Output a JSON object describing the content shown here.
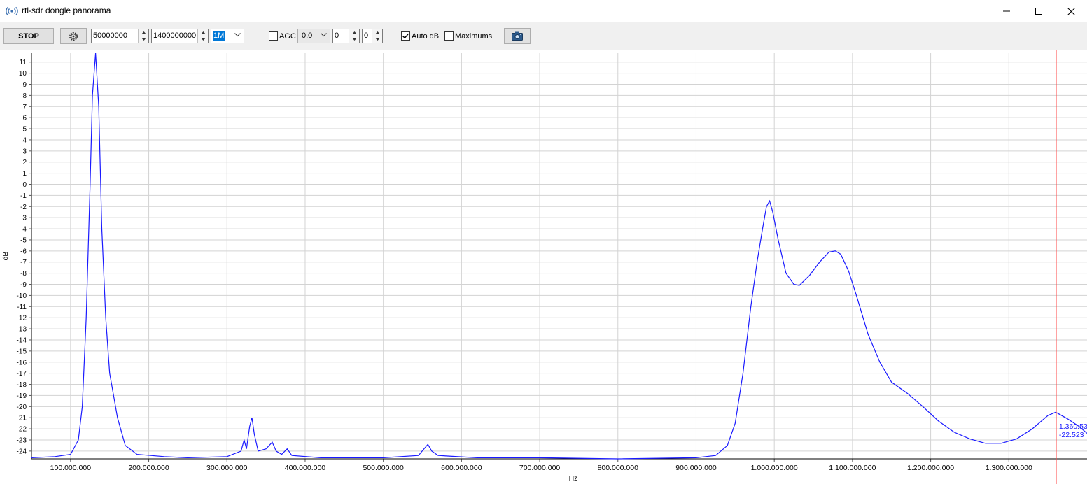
{
  "window": {
    "title": "rtl-sdr dongle panorama"
  },
  "toolbar": {
    "stop_label": "STOP",
    "start_freq": "50000000",
    "stop_freq": "1400000000",
    "step_value": "1M",
    "agc_label": "AGC",
    "agc_checked": false,
    "gain_value": "0.0",
    "spin1_value": "0",
    "spin2_value": "0",
    "autodb_label": "Auto dB",
    "autodb_checked": true,
    "maximums_label": "Maximums",
    "maximums_checked": false
  },
  "cursor": {
    "freq_label": "1.360.53",
    "db_label": "-22.523"
  },
  "chart_data": {
    "type": "line",
    "xlabel": "Hz",
    "ylabel": "dB",
    "xlim": [
      50000000,
      1400000000
    ],
    "ylim": [
      -24.7,
      11.8
    ],
    "x_ticks": [
      {
        "value": 100000000,
        "label": "100.000.000"
      },
      {
        "value": 200000000,
        "label": "200.000.000"
      },
      {
        "value": 300000000,
        "label": "300.000.000"
      },
      {
        "value": 400000000,
        "label": "400.000.000"
      },
      {
        "value": 500000000,
        "label": "500.000.000"
      },
      {
        "value": 600000000,
        "label": "600.000.000"
      },
      {
        "value": 700000000,
        "label": "700.000.000"
      },
      {
        "value": 800000000,
        "label": "800.000.000"
      },
      {
        "value": 900000000,
        "label": "900.000.000"
      },
      {
        "value": 1000000000,
        "label": "1.000.000.000"
      },
      {
        "value": 1100000000,
        "label": "1.100.000.000"
      },
      {
        "value": 1200000000,
        "label": "1.200.000.000"
      },
      {
        "value": 1300000000,
        "label": "1.300.000.000"
      }
    ],
    "y_ticks": [
      11,
      10,
      9,
      8,
      7,
      6,
      5,
      4,
      3,
      2,
      1,
      0,
      -1,
      -2,
      -3,
      -4,
      -5,
      -6,
      -7,
      -8,
      -9,
      -10,
      -11,
      -12,
      -13,
      -14,
      -15,
      -16,
      -17,
      -18,
      -19,
      -20,
      -21,
      -22,
      -23,
      -24
    ],
    "grid": true,
    "series": [
      {
        "color": "#1a1aff",
        "points": [
          [
            50000000,
            -24.6
          ],
          [
            80000000,
            -24.5
          ],
          [
            100000000,
            -24.3
          ],
          [
            110000000,
            -23
          ],
          [
            115000000,
            -20
          ],
          [
            120000000,
            -12
          ],
          [
            125000000,
            0
          ],
          [
            128000000,
            8
          ],
          [
            132000000,
            11.8
          ],
          [
            136000000,
            7
          ],
          [
            140000000,
            -4
          ],
          [
            145000000,
            -12
          ],
          [
            150000000,
            -17
          ],
          [
            160000000,
            -21
          ],
          [
            170000000,
            -23.5
          ],
          [
            185000000,
            -24.3
          ],
          [
            220000000,
            -24.5
          ],
          [
            250000000,
            -24.6
          ],
          [
            300000000,
            -24.5
          ],
          [
            318000000,
            -24
          ],
          [
            322000000,
            -23
          ],
          [
            325000000,
            -23.8
          ],
          [
            329000000,
            -21.8
          ],
          [
            332000000,
            -21
          ],
          [
            335000000,
            -22.5
          ],
          [
            340000000,
            -24
          ],
          [
            350000000,
            -23.8
          ],
          [
            358000000,
            -23.2
          ],
          [
            363000000,
            -24
          ],
          [
            370000000,
            -24.3
          ],
          [
            377000000,
            -23.8
          ],
          [
            383000000,
            -24.4
          ],
          [
            420000000,
            -24.6
          ],
          [
            500000000,
            -24.6
          ],
          [
            545000000,
            -24.4
          ],
          [
            552000000,
            -23.8
          ],
          [
            557000000,
            -23.4
          ],
          [
            562000000,
            -24
          ],
          [
            570000000,
            -24.4
          ],
          [
            620000000,
            -24.6
          ],
          [
            700000000,
            -24.6
          ],
          [
            800000000,
            -24.7
          ],
          [
            900000000,
            -24.6
          ],
          [
            925000000,
            -24.4
          ],
          [
            940000000,
            -23.5
          ],
          [
            950000000,
            -21.5
          ],
          [
            960000000,
            -17
          ],
          [
            970000000,
            -11
          ],
          [
            978000000,
            -7
          ],
          [
            985000000,
            -4
          ],
          [
            990000000,
            -2
          ],
          [
            994000000,
            -1.5
          ],
          [
            998000000,
            -2.5
          ],
          [
            1005000000,
            -5
          ],
          [
            1015000000,
            -8
          ],
          [
            1025000000,
            -9
          ],
          [
            1032000000,
            -9.1
          ],
          [
            1045000000,
            -8.2
          ],
          [
            1058000000,
            -7
          ],
          [
            1070000000,
            -6.1
          ],
          [
            1078000000,
            -6
          ],
          [
            1085000000,
            -6.3
          ],
          [
            1095000000,
            -7.8
          ],
          [
            1105000000,
            -10
          ],
          [
            1120000000,
            -13.5
          ],
          [
            1135000000,
            -16
          ],
          [
            1150000000,
            -17.8
          ],
          [
            1170000000,
            -18.8
          ],
          [
            1190000000,
            -20
          ],
          [
            1210000000,
            -21.3
          ],
          [
            1230000000,
            -22.3
          ],
          [
            1250000000,
            -22.9
          ],
          [
            1270000000,
            -23.3
          ],
          [
            1290000000,
            -23.3
          ],
          [
            1310000000,
            -22.9
          ],
          [
            1330000000,
            -22
          ],
          [
            1350000000,
            -20.8
          ],
          [
            1360000000,
            -20.5
          ],
          [
            1375000000,
            -21.1
          ],
          [
            1390000000,
            -21.8
          ],
          [
            1400000000,
            -22.4
          ]
        ]
      }
    ],
    "cursor_x": 1360530000
  },
  "icons": {
    "app": "antenna-icon",
    "settings": "gear-icon",
    "snapshot": "camera-icon"
  }
}
